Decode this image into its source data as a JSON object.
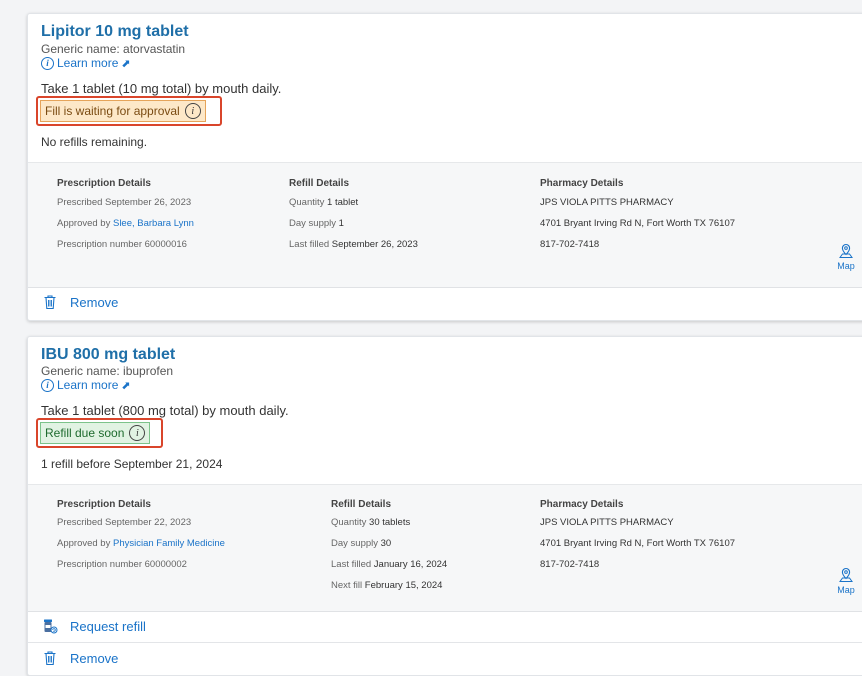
{
  "prescriptions": [
    {
      "name": "Lipitor 10 mg tablet",
      "generic": "Generic name: atorvastatin",
      "learn_more": "Learn more",
      "instructions": "Take 1 tablet (10 mg total) by mouth daily.",
      "badge": "Fill is waiting for approval",
      "badge_tone": "orange",
      "refill_note": "No refills remaining.",
      "details": {
        "prescription_header": "Prescription Details",
        "prescribed": "Prescribed September 26, 2023",
        "approved_by_label": "Approved by",
        "approved_by": "Slee, Barbara Lynn",
        "rx_number": "Prescription number 60000016",
        "refill_header": "Refill Details",
        "quantity_label": "Quantity",
        "quantity": "1 tablet",
        "day_supply_label": "Day supply",
        "day_supply": "1",
        "last_filled_label": "Last filled",
        "last_filled": "September 26, 2023",
        "pharmacy_header": "Pharmacy Details",
        "pharmacy_name": "JPS VIOLA PITTS PHARMACY",
        "pharmacy_address": "4701 Bryant Irving Rd N, Fort Worth TX 76107",
        "pharmacy_phone": "817-702-7418",
        "map_label": "Map"
      },
      "remove_label": "Remove"
    },
    {
      "name": "IBU 800 mg tablet",
      "generic": "Generic name: ibuprofen",
      "learn_more": "Learn more",
      "instructions": "Take 1 tablet (800 mg total) by mouth daily.",
      "badge": "Refill due soon",
      "badge_tone": "green",
      "refill_note": "1 refill before September 21, 2024",
      "details": {
        "prescription_header": "Prescription Details",
        "prescribed": "Prescribed September 22, 2023",
        "approved_by_label": "Approved by",
        "approved_by": "Physician Family Medicine",
        "rx_number": "Prescription number 60000002",
        "refill_header": "Refill Details",
        "quantity_label": "Quantity",
        "quantity": "30 tablets",
        "day_supply_label": "Day supply",
        "day_supply": "30",
        "last_filled_label": "Last filled",
        "last_filled": "January 16, 2024",
        "next_fill_label": "Next fill",
        "next_fill": "February 15, 2024",
        "pharmacy_header": "Pharmacy Details",
        "pharmacy_name": "JPS VIOLA PITTS PHARMACY",
        "pharmacy_address": "4701 Bryant Irving Rd N, Fort Worth TX 76107",
        "pharmacy_phone": "817-702-7418",
        "map_label": "Map"
      },
      "request_refill_label": "Request refill",
      "remove_label": "Remove"
    }
  ],
  "icons": {
    "info": "info-circle-icon",
    "external": "external-link-icon",
    "map": "map-pin-icon",
    "trash": "trash-icon",
    "refill": "pill-bottle-refill-icon"
  },
  "colors": {
    "link": "#1a73c8",
    "title": "#1f6fa8",
    "highlight": "#d9452b",
    "badge_orange_bg": "#fde8c8",
    "badge_green_bg": "#e1f3e3"
  }
}
